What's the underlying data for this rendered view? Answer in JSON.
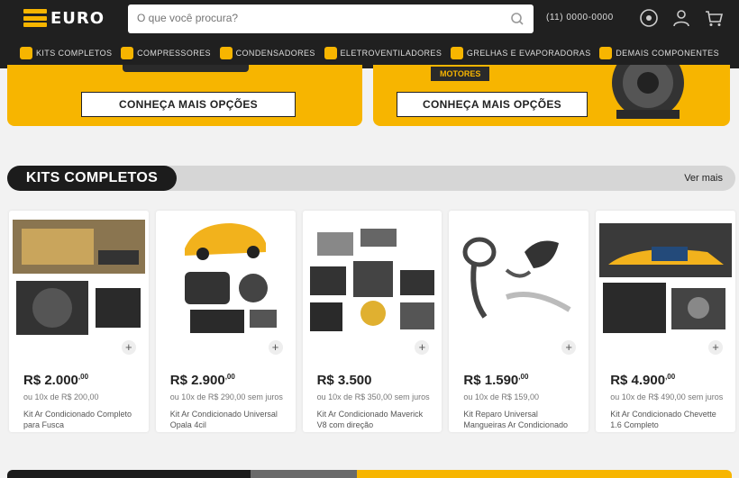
{
  "header": {
    "logo_text": "EURO",
    "search": {
      "placeholder": "O que você procura?",
      "value": ""
    },
    "phone": "(11) 0000-0000",
    "icons": [
      "help-icon",
      "user-icon",
      "cart-icon"
    ]
  },
  "nav": {
    "items": [
      {
        "label": "KITS COMPLETOS",
        "icon": "kit-icon"
      },
      {
        "label": "COMPRESSORES",
        "icon": "compressor-icon"
      },
      {
        "label": "CONDENSADORES",
        "icon": "condenser-icon"
      },
      {
        "label": "ELETROVENTILADORES",
        "icon": "fan-icon"
      },
      {
        "label": "GRELHAS E EVAPORADORAS",
        "icon": "grille-icon"
      },
      {
        "label": "DEMAIS COMPONENTES",
        "icon": "parts-icon"
      }
    ]
  },
  "banners": [
    {
      "button_label": "CONHEÇA MAIS OPÇÕES"
    },
    {
      "tag": "MOTORES",
      "button_label": "CONHEÇA MAIS OPÇÕES"
    }
  ],
  "section": {
    "title": "KITS COMPLETOS",
    "see_more": "Ver mais"
  },
  "products": [
    {
      "price": "R$ 2.000",
      "cents": ",00",
      "installments": "ou 10x de R$ 200,00",
      "desc": "Kit Ar Condicionado Completo para Fusca"
    },
    {
      "price": "R$ 2.900",
      "cents": ",00",
      "installments": "ou 10x de R$ 290,00 sem juros",
      "desc": "Kit Ar Condicionado Universal Opala 4cil"
    },
    {
      "price": "R$ 3.500",
      "cents": "",
      "installments": "ou 10x de R$ 350,00 sem juros",
      "desc": "Kit Ar Condicionado Maverick V8 com direção"
    },
    {
      "price": "R$ 1.590",
      "cents": ",00",
      "installments": "ou 10x de R$ 159,00",
      "desc": "Kit Reparo Universal Mangueiras Ar Condicionado"
    },
    {
      "price": "R$ 4.900",
      "cents": ",00",
      "installments": "ou 10x de R$ 490,00 sem juros",
      "desc": "Kit Ar Condicionado Chevette 1.6 Completo"
    }
  ],
  "colors": {
    "accent": "#f7b500",
    "dark": "#1c1c1c",
    "background": "#f2f2f2"
  }
}
